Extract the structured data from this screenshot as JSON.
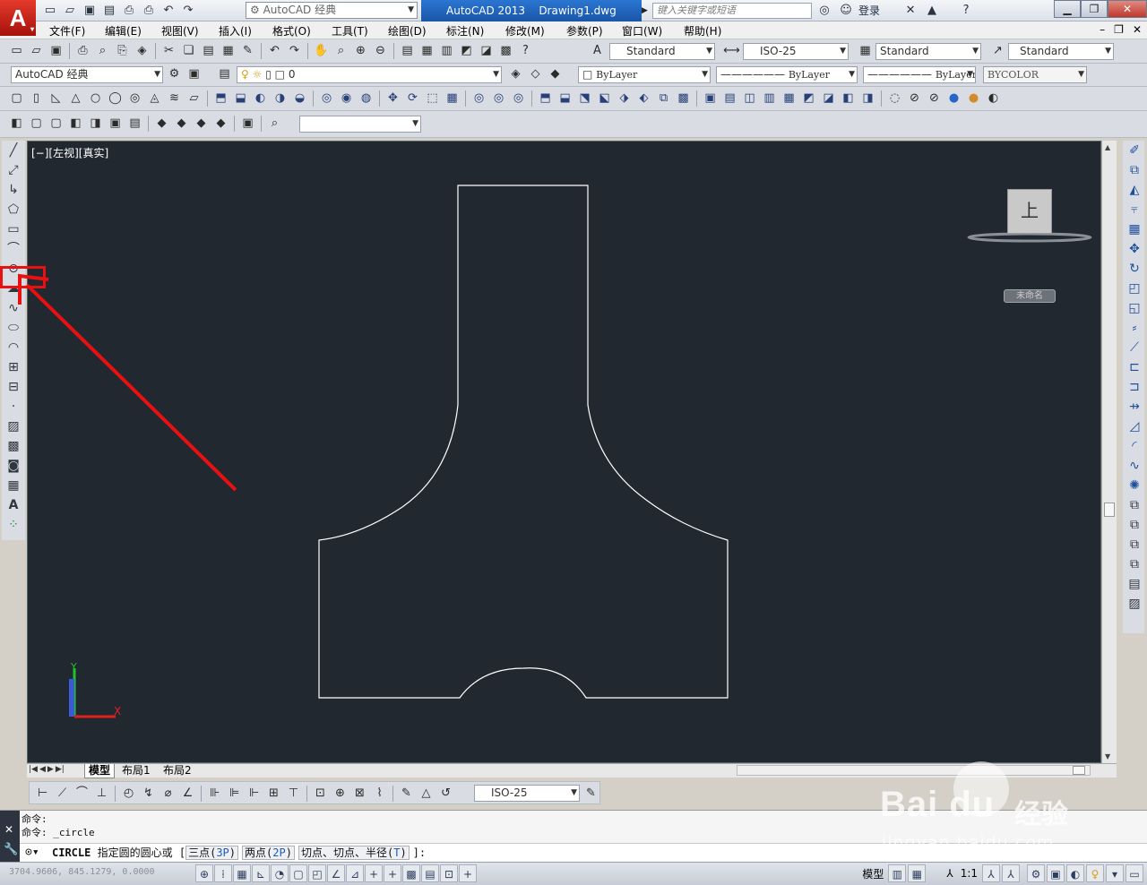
{
  "titlebar": {
    "workspace": "AutoCAD 经典",
    "app_title": "AutoCAD 2013",
    "doc_title": "Drawing1.dwg",
    "search_placeholder": "键入关键字或短语",
    "login": "登录",
    "help": "?"
  },
  "menu": [
    "文件(F)",
    "编辑(E)",
    "视图(V)",
    "插入(I)",
    "格式(O)",
    "工具(T)",
    "绘图(D)",
    "标注(N)",
    "修改(M)",
    "参数(P)",
    "窗口(W)",
    "帮助(H)"
  ],
  "styles": {
    "text_style": "Standard",
    "dim_style": "ISO-25",
    "table_style": "Standard",
    "multileader_style": "Standard"
  },
  "workspace_dropdown": "AutoCAD 经典",
  "layer": "0",
  "properties": {
    "color": "ByLayer",
    "linetype": "ByLayer",
    "lineweight": "ByLayer",
    "plotstyle": "BYCOLOR"
  },
  "viewport": {
    "label": "[−][左视][真实]",
    "viewcube_face": "上",
    "wcs_label": "未命名"
  },
  "layout_tabs": [
    "模型",
    "布局1",
    "布局2"
  ],
  "dim_toolbar_style": "ISO-25",
  "command": {
    "history": [
      "命令:",
      "命令:  _circle"
    ],
    "prompt_name": "CIRCLE",
    "prompt_text": "指定圆的圆心或",
    "options": [
      {
        "label": "三点",
        "key": "3P"
      },
      {
        "label": "两点",
        "key": "2P"
      },
      {
        "label": "切点、切点、半径",
        "key": "T"
      }
    ],
    "prompt_end": "]:"
  },
  "status": {
    "coords": "3704.9606, 845.1279, 0.0000",
    "model": "模型",
    "scale": "1:1"
  },
  "watermark": {
    "logo": "Bai du",
    "brand": "经验",
    "url": "jingyan.baidu.com"
  },
  "colors": {
    "canvas_bg": "#212830",
    "geometry": "#ffffff",
    "annotation": "#e81010",
    "title_active": "#2a76d2"
  },
  "icons": {
    "highlighted_tool": "circle-icon"
  }
}
